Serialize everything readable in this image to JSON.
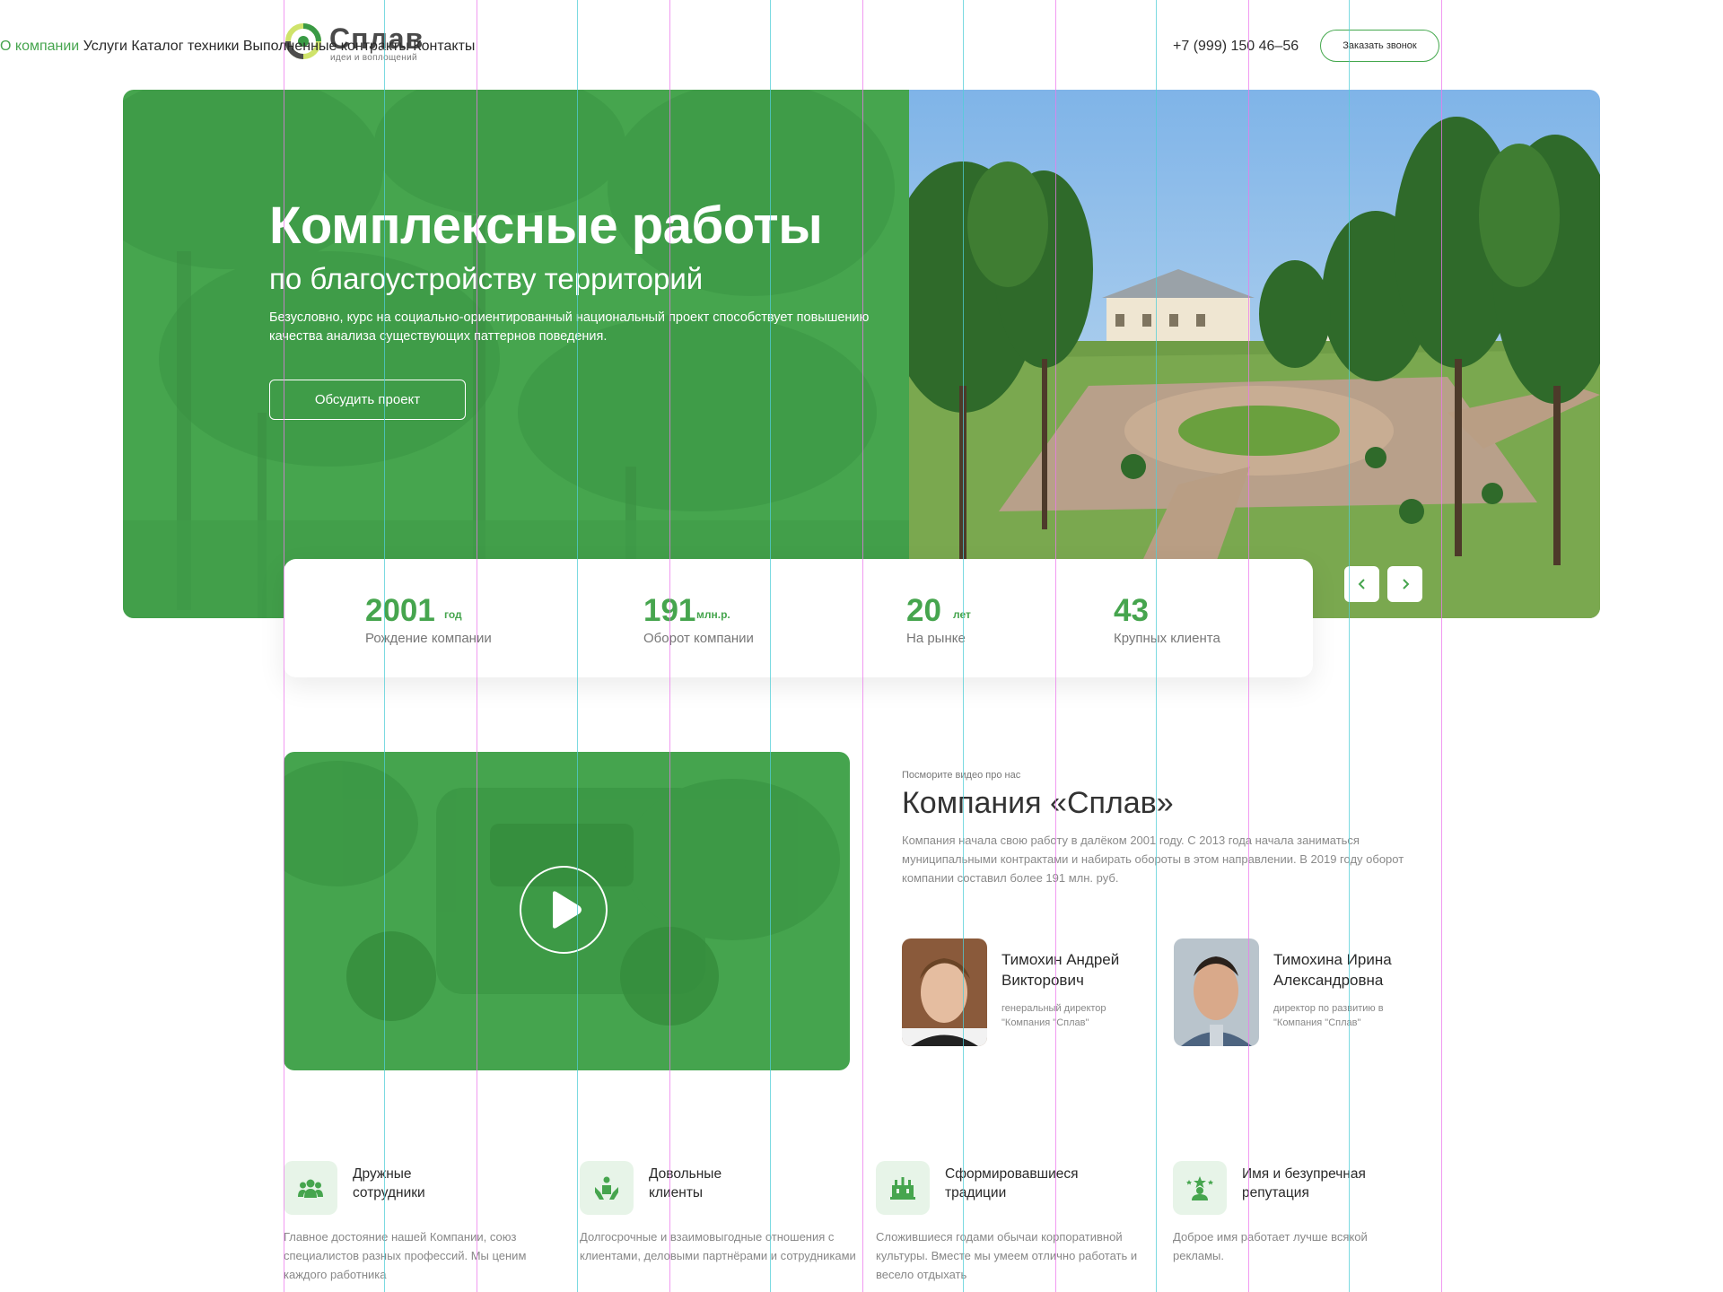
{
  "header": {
    "logo": {
      "name": "Сплав",
      "tagline": "идеи и воплощений"
    },
    "nav": [
      {
        "label": "О компании",
        "active": true
      },
      {
        "label": "Услуги",
        "active": false
      },
      {
        "label": "Каталог техники",
        "active": false
      },
      {
        "label": "Выполненные контракты",
        "active": false
      },
      {
        "label": "Контакты",
        "active": false
      }
    ],
    "phone": "+7 (999) 150 46–56",
    "callback_label": "Заказать звонок"
  },
  "hero": {
    "title": "Комплексные работы",
    "subtitle": "по благоустройству территорий",
    "description": "Безусловно, курс на социально-ориентированный национальный проект способствует повышению качества анализа существующих паттернов поведения.",
    "cta_label": "Обсудить проект",
    "prev_icon": "chevron-left-icon",
    "next_icon": "chevron-right-icon"
  },
  "stats": [
    {
      "value": "2001",
      "unit": "год",
      "label": "Рождение компании"
    },
    {
      "value": "191",
      "unit": "млн.р.",
      "label": "Оборот компании"
    },
    {
      "value": "20",
      "unit": "лет",
      "label": "На рынке"
    },
    {
      "value": "43",
      "unit": "",
      "label": "Крупных клиента"
    }
  ],
  "video": {
    "icon": "play-icon"
  },
  "about": {
    "kicker": "Посморите видео про нас",
    "title": "Компания «Сплав»",
    "text": "Компания начала свою работу в далёком 2001 году. С 2013 года начала заниматься муниципальными контрактами и набирать обороты в этом направлении. В 2019 году оборот компании составил более 191  млн. руб.",
    "people": [
      {
        "name": "Тимохин Андрей Викторович",
        "role": "генеральный директор \"Компания \"Сплав\""
      },
      {
        "name": "Тимохина Ирина Александровна",
        "role": "директор по развитию в \"Компания \"Сплав\""
      }
    ]
  },
  "features": [
    {
      "icon": "team-icon",
      "title": "Дружные сотрудники",
      "text": "Главное достояние нашей Компании, союз специалистов разных профессий. Мы ценим каждого работника"
    },
    {
      "icon": "handshake-icon",
      "title": "Довольные клиенты",
      "text": "Долгосрочные и взаимовыгодные отношения с клиентами, деловыми партнёрами и сотрудниками"
    },
    {
      "icon": "traditions-icon",
      "title": "Сформировавшиеся традиции",
      "text": "Сложившиеся годами обычаи корпоративной культуры. Вместе мы умеем отлично работать и весело отдыхать"
    },
    {
      "icon": "reputation-icon",
      "title": "Имя и безупречная репутация",
      "text": "Доброе имя работает лучше всякой рекламы."
    }
  ],
  "colors": {
    "accent": "#46a54e",
    "accent_light": "#e7f4e8",
    "text": "#2a2a2a",
    "muted": "#888888"
  }
}
